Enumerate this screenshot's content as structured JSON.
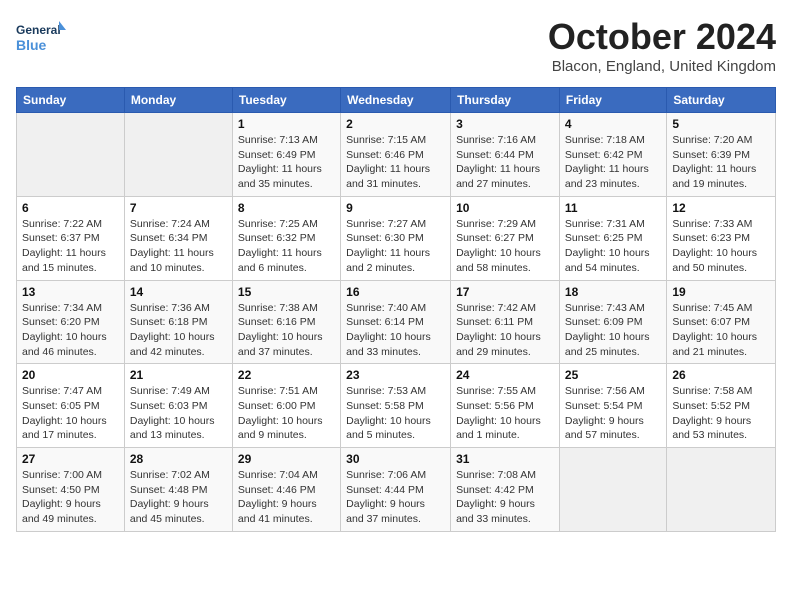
{
  "header": {
    "logo_line1": "General",
    "logo_line2": "Blue",
    "month_title": "October 2024",
    "location": "Blacon, England, United Kingdom"
  },
  "weekdays": [
    "Sunday",
    "Monday",
    "Tuesday",
    "Wednesday",
    "Thursday",
    "Friday",
    "Saturday"
  ],
  "weeks": [
    [
      {
        "day": "",
        "detail": ""
      },
      {
        "day": "",
        "detail": ""
      },
      {
        "day": "1",
        "detail": "Sunrise: 7:13 AM\nSunset: 6:49 PM\nDaylight: 11 hours and 35 minutes."
      },
      {
        "day": "2",
        "detail": "Sunrise: 7:15 AM\nSunset: 6:46 PM\nDaylight: 11 hours and 31 minutes."
      },
      {
        "day": "3",
        "detail": "Sunrise: 7:16 AM\nSunset: 6:44 PM\nDaylight: 11 hours and 27 minutes."
      },
      {
        "day": "4",
        "detail": "Sunrise: 7:18 AM\nSunset: 6:42 PM\nDaylight: 11 hours and 23 minutes."
      },
      {
        "day": "5",
        "detail": "Sunrise: 7:20 AM\nSunset: 6:39 PM\nDaylight: 11 hours and 19 minutes."
      }
    ],
    [
      {
        "day": "6",
        "detail": "Sunrise: 7:22 AM\nSunset: 6:37 PM\nDaylight: 11 hours and 15 minutes."
      },
      {
        "day": "7",
        "detail": "Sunrise: 7:24 AM\nSunset: 6:34 PM\nDaylight: 11 hours and 10 minutes."
      },
      {
        "day": "8",
        "detail": "Sunrise: 7:25 AM\nSunset: 6:32 PM\nDaylight: 11 hours and 6 minutes."
      },
      {
        "day": "9",
        "detail": "Sunrise: 7:27 AM\nSunset: 6:30 PM\nDaylight: 11 hours and 2 minutes."
      },
      {
        "day": "10",
        "detail": "Sunrise: 7:29 AM\nSunset: 6:27 PM\nDaylight: 10 hours and 58 minutes."
      },
      {
        "day": "11",
        "detail": "Sunrise: 7:31 AM\nSunset: 6:25 PM\nDaylight: 10 hours and 54 minutes."
      },
      {
        "day": "12",
        "detail": "Sunrise: 7:33 AM\nSunset: 6:23 PM\nDaylight: 10 hours and 50 minutes."
      }
    ],
    [
      {
        "day": "13",
        "detail": "Sunrise: 7:34 AM\nSunset: 6:20 PM\nDaylight: 10 hours and 46 minutes."
      },
      {
        "day": "14",
        "detail": "Sunrise: 7:36 AM\nSunset: 6:18 PM\nDaylight: 10 hours and 42 minutes."
      },
      {
        "day": "15",
        "detail": "Sunrise: 7:38 AM\nSunset: 6:16 PM\nDaylight: 10 hours and 37 minutes."
      },
      {
        "day": "16",
        "detail": "Sunrise: 7:40 AM\nSunset: 6:14 PM\nDaylight: 10 hours and 33 minutes."
      },
      {
        "day": "17",
        "detail": "Sunrise: 7:42 AM\nSunset: 6:11 PM\nDaylight: 10 hours and 29 minutes."
      },
      {
        "day": "18",
        "detail": "Sunrise: 7:43 AM\nSunset: 6:09 PM\nDaylight: 10 hours and 25 minutes."
      },
      {
        "day": "19",
        "detail": "Sunrise: 7:45 AM\nSunset: 6:07 PM\nDaylight: 10 hours and 21 minutes."
      }
    ],
    [
      {
        "day": "20",
        "detail": "Sunrise: 7:47 AM\nSunset: 6:05 PM\nDaylight: 10 hours and 17 minutes."
      },
      {
        "day": "21",
        "detail": "Sunrise: 7:49 AM\nSunset: 6:03 PM\nDaylight: 10 hours and 13 minutes."
      },
      {
        "day": "22",
        "detail": "Sunrise: 7:51 AM\nSunset: 6:00 PM\nDaylight: 10 hours and 9 minutes."
      },
      {
        "day": "23",
        "detail": "Sunrise: 7:53 AM\nSunset: 5:58 PM\nDaylight: 10 hours and 5 minutes."
      },
      {
        "day": "24",
        "detail": "Sunrise: 7:55 AM\nSunset: 5:56 PM\nDaylight: 10 hours and 1 minute."
      },
      {
        "day": "25",
        "detail": "Sunrise: 7:56 AM\nSunset: 5:54 PM\nDaylight: 9 hours and 57 minutes."
      },
      {
        "day": "26",
        "detail": "Sunrise: 7:58 AM\nSunset: 5:52 PM\nDaylight: 9 hours and 53 minutes."
      }
    ],
    [
      {
        "day": "27",
        "detail": "Sunrise: 7:00 AM\nSunset: 4:50 PM\nDaylight: 9 hours and 49 minutes."
      },
      {
        "day": "28",
        "detail": "Sunrise: 7:02 AM\nSunset: 4:48 PM\nDaylight: 9 hours and 45 minutes."
      },
      {
        "day": "29",
        "detail": "Sunrise: 7:04 AM\nSunset: 4:46 PM\nDaylight: 9 hours and 41 minutes."
      },
      {
        "day": "30",
        "detail": "Sunrise: 7:06 AM\nSunset: 4:44 PM\nDaylight: 9 hours and 37 minutes."
      },
      {
        "day": "31",
        "detail": "Sunrise: 7:08 AM\nSunset: 4:42 PM\nDaylight: 9 hours and 33 minutes."
      },
      {
        "day": "",
        "detail": ""
      },
      {
        "day": "",
        "detail": ""
      }
    ]
  ]
}
